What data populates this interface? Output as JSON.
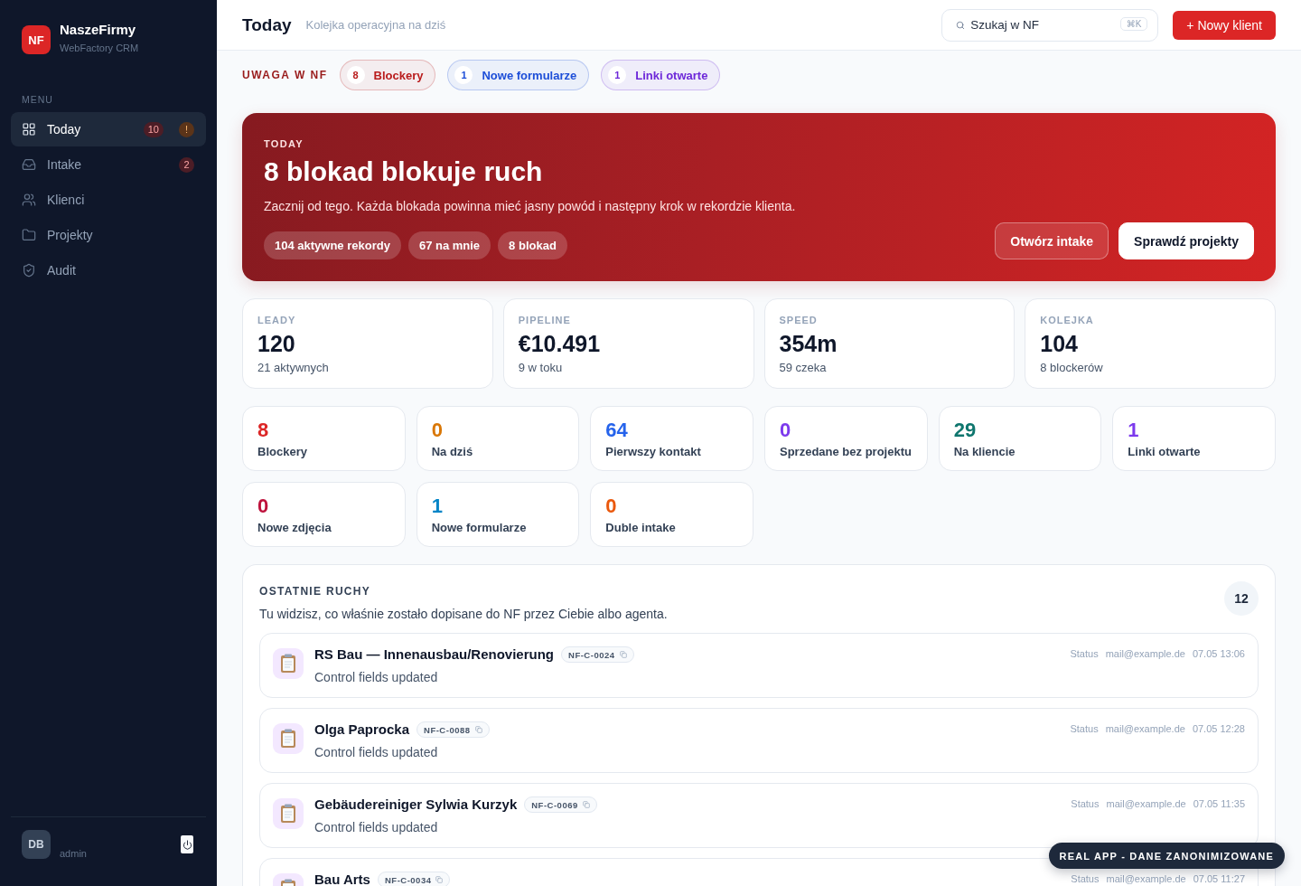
{
  "sidebar": {
    "logo": {
      "mark": "NF",
      "name": "NaszeFirmy",
      "subtitle": "WebFactory CRM"
    },
    "section_label": "MENU",
    "items": [
      {
        "label": "Today",
        "selected": true,
        "badges": [
          {
            "text": "10",
            "kind": "danger"
          },
          {
            "text": "!",
            "kind": "warning"
          }
        ]
      },
      {
        "label": "Intake",
        "selected": false,
        "badges": [
          {
            "text": "2",
            "kind": "danger"
          }
        ]
      },
      {
        "label": "Klienci",
        "selected": false
      },
      {
        "label": "Projekty",
        "selected": false
      },
      {
        "label": "Audit",
        "selected": false
      }
    ],
    "user": {
      "initials": "DB",
      "name": "admin"
    }
  },
  "header": {
    "title": "Today",
    "subtitle": "Kolejka operacyjna na dziś",
    "search": {
      "placeholder": "Szukaj w NF",
      "shortcut": "⌘K"
    },
    "primary_button": "+ Nowy klient"
  },
  "attention": {
    "label": "UWAGA W NF",
    "pills": [
      {
        "count": "8",
        "label": "Blockery",
        "color": "#b91c1c"
      },
      {
        "count": "1",
        "label": "Nowe formularze",
        "color": "#1d4ed8"
      },
      {
        "count": "1",
        "label": "Linki otwarte",
        "color": "#6d28d9"
      }
    ]
  },
  "hero": {
    "eyebrow": "TODAY",
    "title": "8 blokad blokuje ruch",
    "description": "Zacznij od tego. Każda blokada powinna mieć jasny powód i następny krok w rekordzie klienta.",
    "chips": [
      "104 aktywne rekordy",
      "67 na mnie",
      "8 blokad"
    ],
    "buttons": [
      {
        "label": "Otwórz intake",
        "kind": "ghost"
      },
      {
        "label": "Sprawdź projekty",
        "kind": "solid"
      }
    ]
  },
  "kpis": [
    {
      "label": "LEADY",
      "value": "120",
      "note": "21 aktywnych"
    },
    {
      "label": "PIPELINE",
      "value": "€10.491",
      "note": "9 w toku"
    },
    {
      "label": "SPEED",
      "value": "354m",
      "note": "59 czeka"
    },
    {
      "label": "KOLEJKA",
      "value": "104",
      "note": "8 blockerów"
    }
  ],
  "counters": [
    {
      "value": "8",
      "label": "Blockery",
      "color": "#dc2626"
    },
    {
      "value": "0",
      "label": "Na dziś",
      "color": "#d97706"
    },
    {
      "value": "64",
      "label": "Pierwszy kontakt",
      "color": "#2563eb"
    },
    {
      "value": "0",
      "label": "Sprzedane bez projektu",
      "color": "#7c3aed"
    },
    {
      "value": "29",
      "label": "Na kliencie",
      "color": "#0f766e"
    },
    {
      "value": "1",
      "label": "Linki otwarte",
      "color": "#7c3aed"
    },
    {
      "value": "0",
      "label": "Nowe zdjęcia",
      "color": "#be123c"
    },
    {
      "value": "1",
      "label": "Nowe formularze",
      "color": "#0284c7"
    },
    {
      "value": "0",
      "label": "Duble intake",
      "color": "#ea580c"
    }
  ],
  "activity": {
    "title": "OSTATNIE RUCHY",
    "description": "Tu widzisz, co właśnie zostało dopisane do NF przez Ciebie albo agenta.",
    "count": "12",
    "items": [
      {
        "title": "RS Bau — Innenausbau/Renovierung",
        "id": "NF-C-0024",
        "summary": "Control fields updated",
        "type": "Status",
        "email": "mail@example.de",
        "time": "07.05 13:06"
      },
      {
        "title": "Olga Paprocka",
        "id": "NF-C-0088",
        "summary": "Control fields updated",
        "type": "Status",
        "email": "mail@example.de",
        "time": "07.05 12:28"
      },
      {
        "title": "Gebäudereiniger Sylwia Kurzyk",
        "id": "NF-C-0069",
        "summary": "Control fields updated",
        "type": "Status",
        "email": "mail@example.de",
        "time": "07.05 11:35"
      },
      {
        "title": "Bau Arts",
        "id": "NF-C-0034",
        "type": "Status",
        "email": "mail@example.de",
        "time": "07.05 11:27"
      }
    ]
  },
  "notice": "REAL APP - DANE ZANONIMIZOWANE"
}
